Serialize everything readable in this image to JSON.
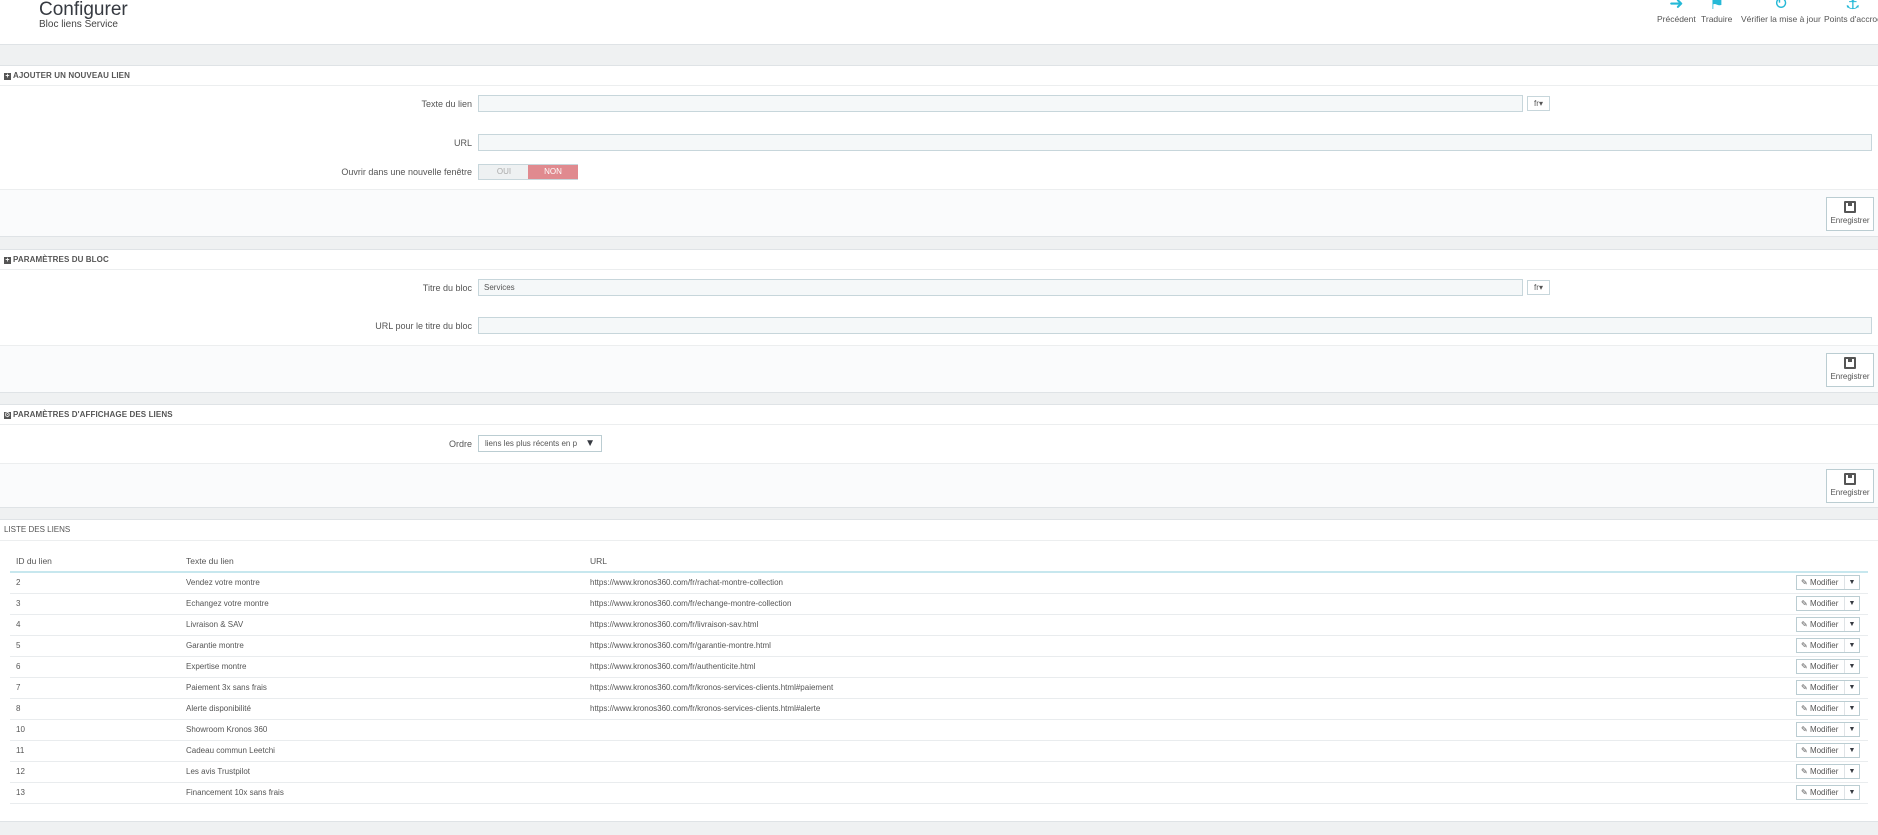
{
  "header": {
    "title": "Configurer",
    "subtitle": "Bloc liens Service",
    "toolbar": [
      {
        "label": "Précédent",
        "icon": "arrow-left-circle-icon"
      },
      {
        "label": "Traduire",
        "icon": "flag-icon"
      },
      {
        "label": "Vérifier la mise à jour",
        "icon": "refresh-icon"
      },
      {
        "label": "Points d'accroc",
        "icon": "anchor-icon"
      }
    ]
  },
  "add_link": {
    "heading": "AJOUTER UN NOUVEAU LIEN",
    "link_text_label": "Texte du lien",
    "link_text_value": "",
    "lang": "fr",
    "url_label": "URL",
    "url_value": "",
    "new_window_label": "Ouvrir dans une nouvelle fenêtre",
    "yes": "OUI",
    "no": "NON",
    "save": "Enregistrer"
  },
  "block_params": {
    "heading": "PARAMÈTRES DU BLOC",
    "title_label": "Titre du bloc",
    "title_value": "Services",
    "lang": "fr",
    "title_url_label": "URL pour le titre du bloc",
    "title_url_value": "",
    "save": "Enregistrer"
  },
  "display_params": {
    "heading": "PARAMÈTRES D'AFFICHAGE DES LIENS",
    "order_label": "Ordre",
    "order_value": "liens les plus récents en p",
    "save": "Enregistrer"
  },
  "links_list": {
    "heading": "LISTE DES LIENS",
    "columns": [
      "ID du lien",
      "Texte du lien",
      "URL"
    ],
    "edit_label": "Modifier",
    "rows": [
      {
        "id": "2",
        "text": "Vendez votre montre",
        "url": "https://www.kronos360.com/fr/rachat-montre-collection"
      },
      {
        "id": "3",
        "text": "Echangez votre montre",
        "url": "https://www.kronos360.com/fr/echange-montre-collection"
      },
      {
        "id": "4",
        "text": "Livraison & SAV",
        "url": "https://www.kronos360.com/fr/livraison-sav.html"
      },
      {
        "id": "5",
        "text": "Garantie montre",
        "url": "https://www.kronos360.com/fr/garantie-montre.html"
      },
      {
        "id": "6",
        "text": "Expertise montre",
        "url": "https://www.kronos360.com/fr/authenticite.html"
      },
      {
        "id": "7",
        "text": "Paiement 3x sans frais",
        "url": "https://www.kronos360.com/fr/kronos-services-clients.html#paiement"
      },
      {
        "id": "8",
        "text": "Alerte disponibilité",
        "url": "https://www.kronos360.com/fr/kronos-services-clients.html#alerte"
      },
      {
        "id": "10",
        "text": "Showroom Kronos 360",
        "url": ""
      },
      {
        "id": "11",
        "text": "Cadeau commun Leetchi",
        "url": ""
      },
      {
        "id": "12",
        "text": "Les avis Trustpilot",
        "url": ""
      },
      {
        "id": "13",
        "text": "Financement 10x sans frais",
        "url": ""
      }
    ]
  },
  "colors": {
    "accent": "#25b9d7",
    "danger": "#e08a8f",
    "background": "#eff1f2"
  }
}
